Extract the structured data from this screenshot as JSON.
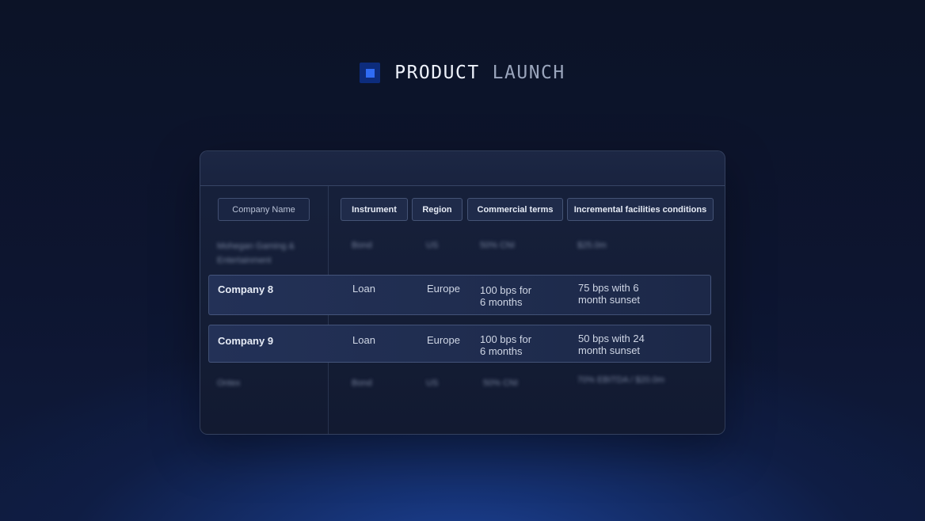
{
  "brand": {
    "icon": "square-logo-icon",
    "word1": "PRODUCT",
    "word2": "LAUNCH",
    "colors": {
      "accent": "#2f6cf5",
      "icon_bg": "#0d2c7c"
    }
  },
  "table": {
    "columns": {
      "company": "Company Name",
      "instrument": "Instrument",
      "region": "Region",
      "terms": "Commercial terms",
      "incremental": "Incremental facilities conditions"
    },
    "rows": [
      {
        "company": "Mohegan Gaming & Entertainment",
        "instrument": "Bond",
        "region": "US",
        "terms": "50% CNI",
        "incremental": "$25.0m"
      },
      {
        "company": "Company 8",
        "instrument": "Loan",
        "region": "Europe",
        "terms": "100 bps for\n6 months",
        "incremental": "75 bps with 6\nmonth sunset"
      },
      {
        "company": "Company 9",
        "instrument": "Loan",
        "region": "Europe",
        "terms": "100 bps for\n6 months",
        "incremental": "50 bps with 24\nmonth sunset"
      },
      {
        "company": "Ontex",
        "instrument": "Bond",
        "region": "US",
        "terms": "50% CNI",
        "incremental": "70% EBITDA / $20.0m"
      }
    ]
  }
}
